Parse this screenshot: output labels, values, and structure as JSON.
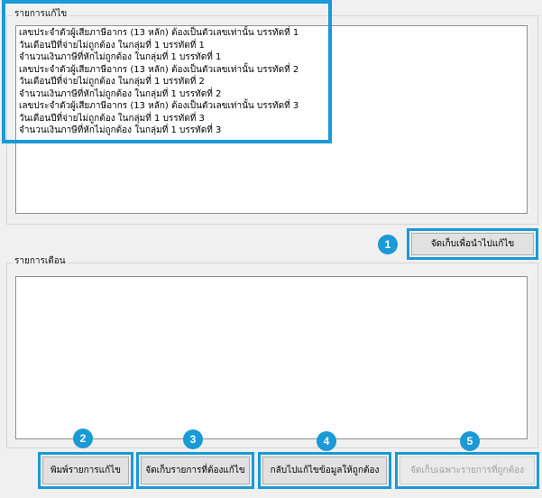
{
  "corrections": {
    "label": "รายการแก้ไข",
    "lines": [
      "เลขประจำตัวผู้เสียภาษีอากร (13 หลัก) ต้องเป็นตัวเลขเท่านั้น บรรทัดที่  1",
      "วันเดือนปีที่จ่ายไม่ถูกต้อง ในกลุ่มที่ 1 บรรทัดที่ 1",
      "จำนวนเงินภาษีที่หักไม่ถูกต้อง ในกลุ่มที่ 1 บรรทัดที่   1",
      "เลขประจำตัวผู้เสียภาษีอากร (13 หลัก) ต้องเป็นตัวเลขเท่านั้น บรรทัดที่  2",
      "วันเดือนปีที่จ่ายไม่ถูกต้อง ในกลุ่มที่ 1 บรรทัดที่ 2",
      "จำนวนเงินภาษีที่หักไม่ถูกต้อง ในกลุ่มที่ 1 บรรทัดที่   2",
      "เลขประจำตัวผู้เสียภาษีอากร (13 หลัก) ต้องเป็นตัวเลขเท่านั้น บรรทัดที่  3",
      "วันเดือนปีที่จ่ายไม่ถูกต้อง ในกลุ่มที่ 1 บรรทัดที่ 3",
      "จำนวนเงินภาษีที่หักไม่ถูกต้อง ในกลุ่มที่ 1 บรรทัดที่   3"
    ]
  },
  "save_for_fix_button": {
    "label": "จัดเก็บเพื่อนำไปแก้ไข",
    "badge": "1"
  },
  "warnings": {
    "label": "รายการเตือน",
    "lines": []
  },
  "buttons": {
    "print": {
      "label": "พิมพ์รายการแก้ไข",
      "badge": "2"
    },
    "save_items": {
      "label": "จัดเก็บรายการที่ต้องแก้ไข",
      "badge": "3"
    },
    "go_back": {
      "label": "กลับไปแก้ไขข้อมูลให้ถูกต้อง",
      "badge": "4"
    },
    "save_correct": {
      "label": "จัดเก็บเฉพาะรายการที่ถูกต้อง",
      "badge": "5",
      "disabled": true
    }
  },
  "colors": {
    "highlight": "#1a9ad6",
    "badge": "#1a9ad6"
  }
}
